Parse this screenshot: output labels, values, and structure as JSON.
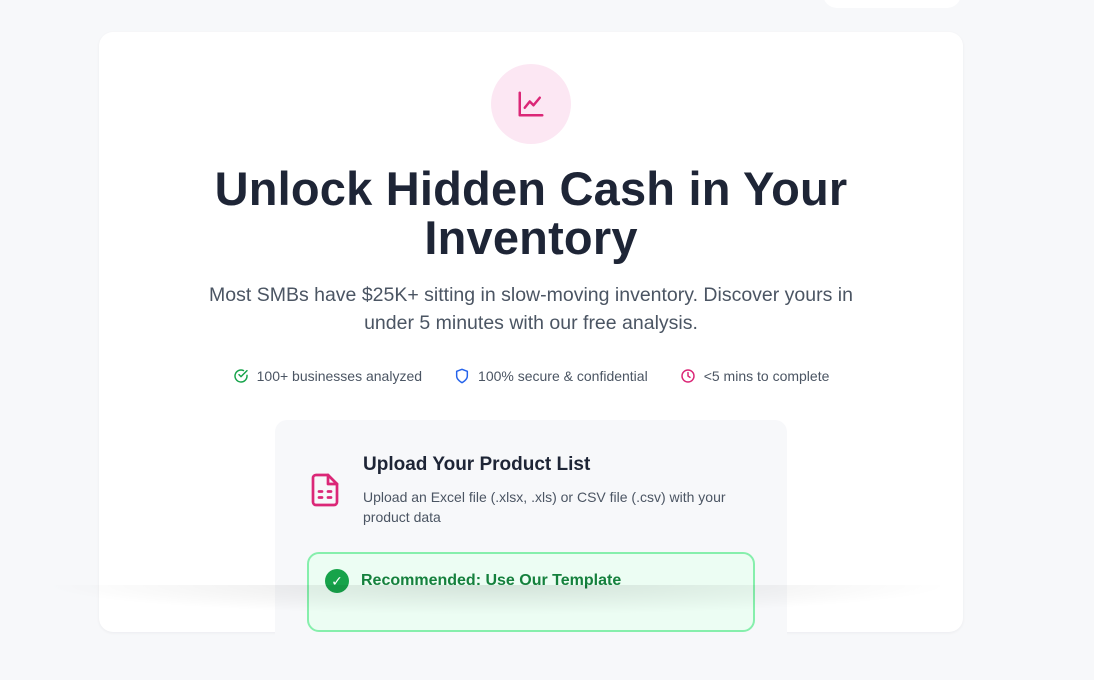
{
  "hero": {
    "icon": "chart-line-icon",
    "title": "Unlock Hidden Cash in Your Inventory",
    "subtitle": "Most SMBs have $25K+ sitting in slow-moving inventory. Discover yours in under 5 minutes with our free analysis."
  },
  "trust": [
    {
      "icon": "check-circle-icon",
      "label": "100+ businesses analyzed",
      "color": "#16a34a"
    },
    {
      "icon": "shield-icon",
      "label": "100% secure & confidential",
      "color": "#2563eb"
    },
    {
      "icon": "clock-icon",
      "label": "<5 mins to complete",
      "color": "#db2777"
    }
  ],
  "upload": {
    "icon": "file-spreadsheet-icon",
    "title": "Upload Your Product List",
    "description": "Upload an Excel file (.xlsx, .xls) or CSV file (.csv) with your product data",
    "recommended": {
      "icon": "check-icon",
      "title": "Recommended: Use Our Template"
    }
  },
  "colors": {
    "accent": "#db2777",
    "accent_bg": "#fce7f3",
    "success": "#16a34a",
    "success_bg": "#ecfdf3",
    "heading": "#1e2536"
  }
}
